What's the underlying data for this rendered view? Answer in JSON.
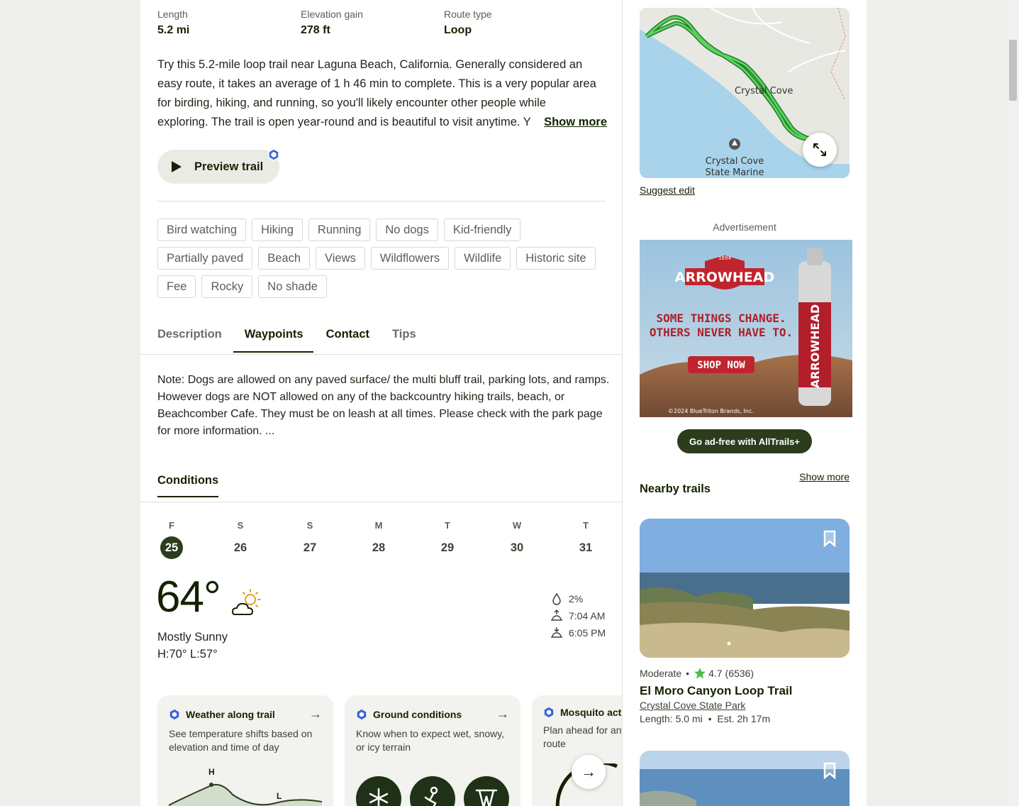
{
  "stats": [
    {
      "label": "Length",
      "value": "5.2 mi"
    },
    {
      "label": "Elevation gain",
      "value": "278 ft"
    },
    {
      "label": "Route type",
      "value": "Loop"
    }
  ],
  "description": {
    "lines": [
      "Try this 5.2-mile loop trail near Laguna Beach, California. Generally considered an",
      "easy route, it takes an average of 1 h 46 min to complete. This is a very popular area",
      "for birding, hiking, and running, so you'll likely encounter other people while",
      "exploring. The trail is open year-round and is beautiful to visit anytime. Y"
    ],
    "show_more": "Show more"
  },
  "preview_trail": "Preview trail",
  "tags": [
    [
      "Bird watching",
      "Hiking",
      "Running",
      "No dogs",
      "Kid-friendly"
    ],
    [
      "Partially paved",
      "Beach",
      "Views",
      "Wildflowers",
      "Wildlife",
      "Historic site"
    ],
    [
      "Fee",
      "Rocky",
      "No shade"
    ]
  ],
  "tabs": [
    "Description",
    "Waypoints",
    "Contact",
    "Tips"
  ],
  "active_tab": "Waypoints",
  "note": "Note: Dogs are allowed on any paved surface/ the multi bluff trail, parking lots, and ramps. However dogs are NOT allowed on any of the backcountry hiking trails, beach, or Beachcomber Cafe. They must be on leash at all times. Please check with the park page for more information. ...",
  "conditions": {
    "title": "Conditions",
    "days": [
      {
        "letter": "F",
        "num": "25",
        "selected": true
      },
      {
        "letter": "S",
        "num": "26"
      },
      {
        "letter": "S",
        "num": "27"
      },
      {
        "letter": "M",
        "num": "28"
      },
      {
        "letter": "T",
        "num": "29"
      },
      {
        "letter": "W",
        "num": "30"
      },
      {
        "letter": "T",
        "num": "31"
      }
    ],
    "temperature": "64°",
    "sky": "Mostly Sunny",
    "hi_lo": "H:70°  L:57°",
    "precip": "2%",
    "sunrise": "7:04 AM",
    "sunset": "6:05 PM"
  },
  "cards": [
    {
      "title": "Weather along trail",
      "desc": "See temperature shifts based on elevation and time of day",
      "chart_h": "H",
      "chart_l": "L"
    },
    {
      "title": "Ground conditions",
      "desc": "Know when to expect wet, snowy, or icy terrain"
    },
    {
      "title": "Mosquito activity",
      "desc": "Plan ahead for any bugs on your route"
    }
  ],
  "map": {
    "label_cove": "Crystal Cove",
    "label_park_1": "Crystal Cove",
    "label_park_2": "State Marine"
  },
  "suggest_edit": "Suggest edit",
  "advertisement": "Advertisement",
  "ad": {
    "brand": "ARROWHEAD",
    "year": "1894",
    "line1": "SOME THINGS CHANGE.",
    "line2": "OTHERS NEVER HAVE TO.",
    "cta": "SHOP NOW",
    "copyright": "©2024 BlueTriton Brands, Inc."
  },
  "go_ad_free": "Go ad-free with AllTrails+",
  "nearby": {
    "title": "Nearby trails",
    "show_more": "Show more",
    "trail": {
      "difficulty": "Moderate",
      "rating": "4.7",
      "reviews": "(6536)",
      "name": "El Moro Canyon Loop Trail",
      "park": "Crystal Cove State Park",
      "length": "Length: 5.0 mi",
      "est": "Est. 2h 17m"
    }
  },
  "colors": {
    "brand_dark": "#2c3d1e",
    "text": "#142200",
    "star": "#4bbf4b",
    "plus_badge": "#3a64d8"
  }
}
